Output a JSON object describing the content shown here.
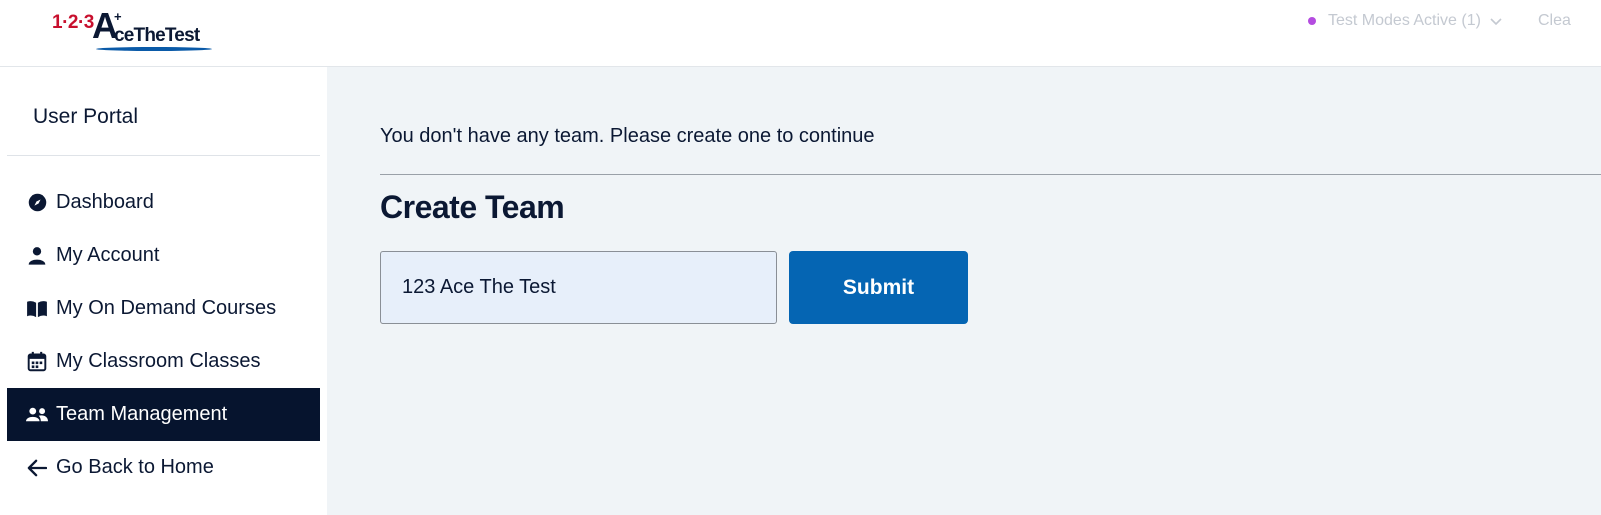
{
  "header": {
    "logo_numbers": "1·2·3",
    "logo_letter": "A",
    "logo_plus": "+",
    "logo_word": "ceTheTest",
    "test_modes_label": "Test Modes Active (1)",
    "clear_label": "Clea"
  },
  "sidebar": {
    "title": "User Portal",
    "items": [
      {
        "label": "Dashboard",
        "icon": "compass-icon",
        "active": false
      },
      {
        "label": "My Account",
        "icon": "user-icon",
        "active": false
      },
      {
        "label": "My On Demand Courses",
        "icon": "book-icon",
        "active": false
      },
      {
        "label": "My Classroom Classes",
        "icon": "calendar-icon",
        "active": false
      },
      {
        "label": "Team Management",
        "icon": "users-icon",
        "active": true
      },
      {
        "label": "Go Back to Home",
        "icon": "arrow-left-icon",
        "active": false
      }
    ]
  },
  "main": {
    "notice": "You don't have any team. Please create one to continue",
    "heading": "Create Team",
    "team_name_value": "123 Ace The Test",
    "submit_label": "Submit"
  },
  "colors": {
    "brand_red": "#c8102e",
    "navy": "#06142e",
    "primary_blue": "#0565b3",
    "status_dot": "#b44ce0",
    "main_bg": "#f0f4f7"
  }
}
